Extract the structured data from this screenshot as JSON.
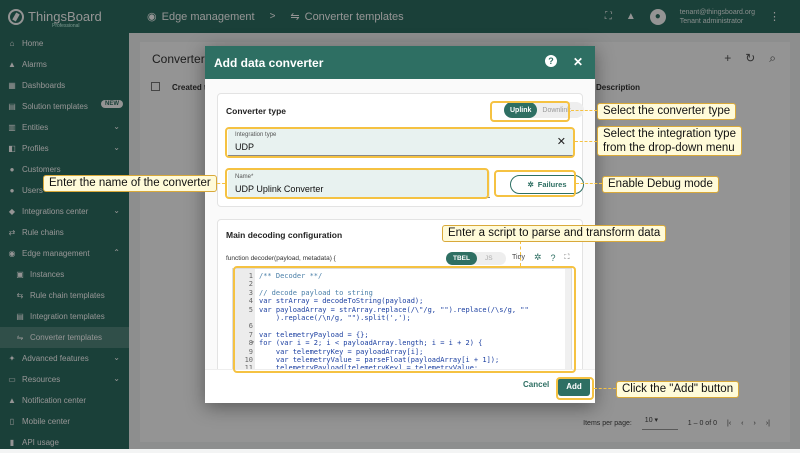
{
  "brand": {
    "name": "ThingsBoard",
    "sub": "Professional"
  },
  "sidebar": {
    "items": [
      {
        "label": "Home",
        "icon": "home-icon",
        "glyph": "⌂"
      },
      {
        "label": "Alarms",
        "icon": "bell-icon",
        "glyph": "▲"
      },
      {
        "label": "Dashboards",
        "icon": "dashboard-icon",
        "glyph": "▦"
      },
      {
        "label": "Solution templates",
        "icon": "template-icon",
        "glyph": "▤",
        "badge": "NEW"
      },
      {
        "label": "Entities",
        "icon": "entities-icon",
        "glyph": "▥",
        "chevron": "⌄"
      },
      {
        "label": "Profiles",
        "icon": "profiles-icon",
        "glyph": "◧",
        "chevron": "⌄"
      },
      {
        "label": "Customers",
        "icon": "customers-icon",
        "glyph": "●"
      },
      {
        "label": "Users",
        "icon": "users-icon",
        "glyph": "●"
      },
      {
        "label": "Integrations center",
        "icon": "integrations-icon",
        "glyph": "◆",
        "chevron": "⌄"
      },
      {
        "label": "Rule chains",
        "icon": "rule-chains-icon",
        "glyph": "⇄"
      },
      {
        "label": "Edge management",
        "icon": "edge-icon",
        "glyph": "◉",
        "chevron": "⌃"
      },
      {
        "label": "Instances",
        "icon": "instances-icon",
        "glyph": "▣",
        "sub": true
      },
      {
        "label": "Rule chain templates",
        "icon": "rule-chain-templates-icon",
        "glyph": "⇆",
        "sub": true
      },
      {
        "label": "Integration templates",
        "icon": "integration-templates-icon",
        "glyph": "▤",
        "sub": true
      },
      {
        "label": "Converter templates",
        "icon": "converter-templates-icon",
        "glyph": "⇋",
        "sub": true,
        "active": true
      },
      {
        "label": "Advanced features",
        "icon": "advanced-icon",
        "glyph": "✦",
        "chevron": "⌄"
      },
      {
        "label": "Resources",
        "icon": "resources-icon",
        "glyph": "▭",
        "chevron": "⌄"
      },
      {
        "label": "Notification center",
        "icon": "notification-icon",
        "glyph": "▲"
      },
      {
        "label": "Mobile center",
        "icon": "mobile-icon",
        "glyph": "▯"
      },
      {
        "label": "API usage",
        "icon": "api-usage-icon",
        "glyph": "▮"
      }
    ]
  },
  "topbar": {
    "crumb1": "Edge management",
    "crumb2": "Converter templates",
    "sep": ">",
    "user_email": "tenant@thingsboard.org",
    "user_role": "Tenant administrator"
  },
  "main": {
    "title": "Converter te",
    "col_created": "Created ti",
    "col_description": "Description",
    "items_per_page_label": "Items per page:",
    "items_per_page_value": "10",
    "range": "1 – 0 of 0"
  },
  "dialog": {
    "title": "Add data converter",
    "converter_type_title": "Converter type",
    "uplink_label": "Uplink",
    "downlink_label": "Downlink",
    "integration_type_label": "Integration type",
    "integration_type_value": "UDP",
    "name_label": "Name*",
    "name_value": "UDP Uplink Converter",
    "failures_label": "Failures",
    "decoding_title": "Main decoding configuration",
    "function_signature": "function decoder(payload, metadata) {",
    "lang_tbel": "TBEL",
    "lang_js": "JS",
    "tidy_label": "Tidy",
    "cancel_label": "Cancel",
    "add_label": "Add",
    "code_lines": [
      {
        "n": "1",
        "text": "/** Decoder **/",
        "comment": true
      },
      {
        "n": "2",
        "text": ""
      },
      {
        "n": "3",
        "text": "// decode payload to string",
        "comment": true
      },
      {
        "n": "4",
        "text": "var strArray = decodeToString(payload);"
      },
      {
        "n": "5",
        "text": "var payloadArray = strArray.replace(/\\\"/g, \"\").replace(/\\s/g, \"\""
      },
      {
        "n": "",
        "text": "    ).replace(/\\n/g, \"\").split(',');"
      },
      {
        "n": "6",
        "text": ""
      },
      {
        "n": "7",
        "text": "var telemetryPayload = {};"
      },
      {
        "n": "8",
        "text": "for (var i = 2; i < payloadArray.length; i = i + 2) {",
        "fold": true
      },
      {
        "n": "9",
        "text": "    var telemetryKey = payloadArray[i];"
      },
      {
        "n": "10",
        "text": "    var telemetryValue = parseFloat(payloadArray[i + 1]);"
      },
      {
        "n": "11",
        "text": "    telemetryPayload[telemetryKey] = telemetryValue;"
      }
    ]
  },
  "annotations": {
    "select_type": "Select the converter type",
    "select_integration_1": "Select the integration type",
    "select_integration_2": "from the drop-down menu",
    "enter_name": "Enter the name of the converter",
    "debug": "Enable Debug mode",
    "script": "Enter a script to parse and transform data",
    "click_add": "Click the \"Add\" button"
  },
  "colors": {
    "primary": "#2e6f63",
    "highlight": "#f5c242",
    "callout_bg": "#fffbd9"
  }
}
